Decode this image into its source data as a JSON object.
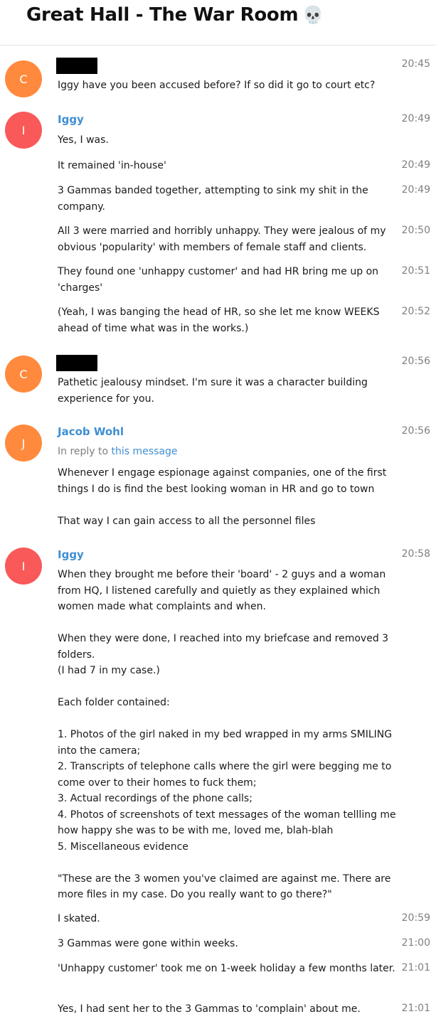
{
  "chat": {
    "title": "Great Hall - The War Room",
    "title_emoji": "💀"
  },
  "reply_prefix": "In reply to ",
  "groups": [
    {
      "avatar_letter": "C",
      "avatar_color": "#ff8a3d",
      "sender": "",
      "sender_redacted": true,
      "messages": [
        {
          "time": "20:45",
          "text": "Iggy have you been accused before? If so did it go to court etc?"
        }
      ]
    },
    {
      "avatar_letter": "I",
      "avatar_color": "#f95959",
      "sender": "Iggy",
      "messages": [
        {
          "time": "20:49",
          "text": "Yes, I was."
        },
        {
          "time": "20:49",
          "text": "It remained 'in-house'"
        },
        {
          "time": "20:49",
          "text": "3 Gammas banded together, attempting to sink my shit in the company."
        },
        {
          "time": "20:50",
          "text": "All 3 were married and horribly unhappy. They were jealous of my obvious 'popularity' with members of female staff and clients."
        },
        {
          "time": "20:51",
          "text": "They found one 'unhappy customer' and had HR bring me up on 'charges'"
        },
        {
          "time": "20:52",
          "text": "(Yeah, I was banging the head of HR, so she let me know WEEKS ahead of time what was in the works.)"
        }
      ]
    },
    {
      "avatar_letter": "C",
      "avatar_color": "#ff8a3d",
      "sender": "",
      "sender_redacted": true,
      "messages": [
        {
          "time": "20:56",
          "text": "Pathetic jealousy mindset. I'm sure it was a character building experience for you."
        }
      ]
    },
    {
      "avatar_letter": "J",
      "avatar_color": "#ff8a3d",
      "sender": "Jacob Wohl",
      "reply_link": "this message",
      "messages": [
        {
          "time": "20:56",
          "text": "Whenever I engage espionage against companies, one of the first things I do is find the best looking woman in HR and go to town\n\nThat way I can gain access to all the personnel files"
        }
      ]
    },
    {
      "avatar_letter": "I",
      "avatar_color": "#f95959",
      "sender": "Iggy",
      "messages": [
        {
          "time": "20:58",
          "text": "When they brought me before their 'board' - 2 guys and a woman from HQ, I listened carefully and quietly as they explained which women made what complaints and when.\n\nWhen they were done, I reached into my briefcase and removed 3 folders.\n(I had 7 in my case.)\n\nEach folder contained:\n\n1. Photos of the girl naked in my bed wrapped in my arms SMILING into the camera;\n2. Transcripts of telephone calls where the girl were begging me to come over to their homes to fuck them;\n3. Actual recordings of the phone calls;\n4. Photos of screenshots of text messages of the woman tellling me how happy she was to be with me, loved me, blah-blah\n5. Miscellaneous evidence\n\n\"These are the 3 women you've claimed are against me. There are more files in my case. Do you really want to go there?\""
        },
        {
          "time": "20:59",
          "text": "I skated."
        },
        {
          "time": "21:00",
          "text": "3 Gammas were gone within weeks."
        },
        {
          "time": "21:01",
          "text": "'Unhappy customer' took me on 1-week holiday a few months later."
        },
        {
          "time": "21:01",
          "text": "Yes, I had sent her to the 3 Gammas to 'complain' about me."
        }
      ]
    }
  ]
}
